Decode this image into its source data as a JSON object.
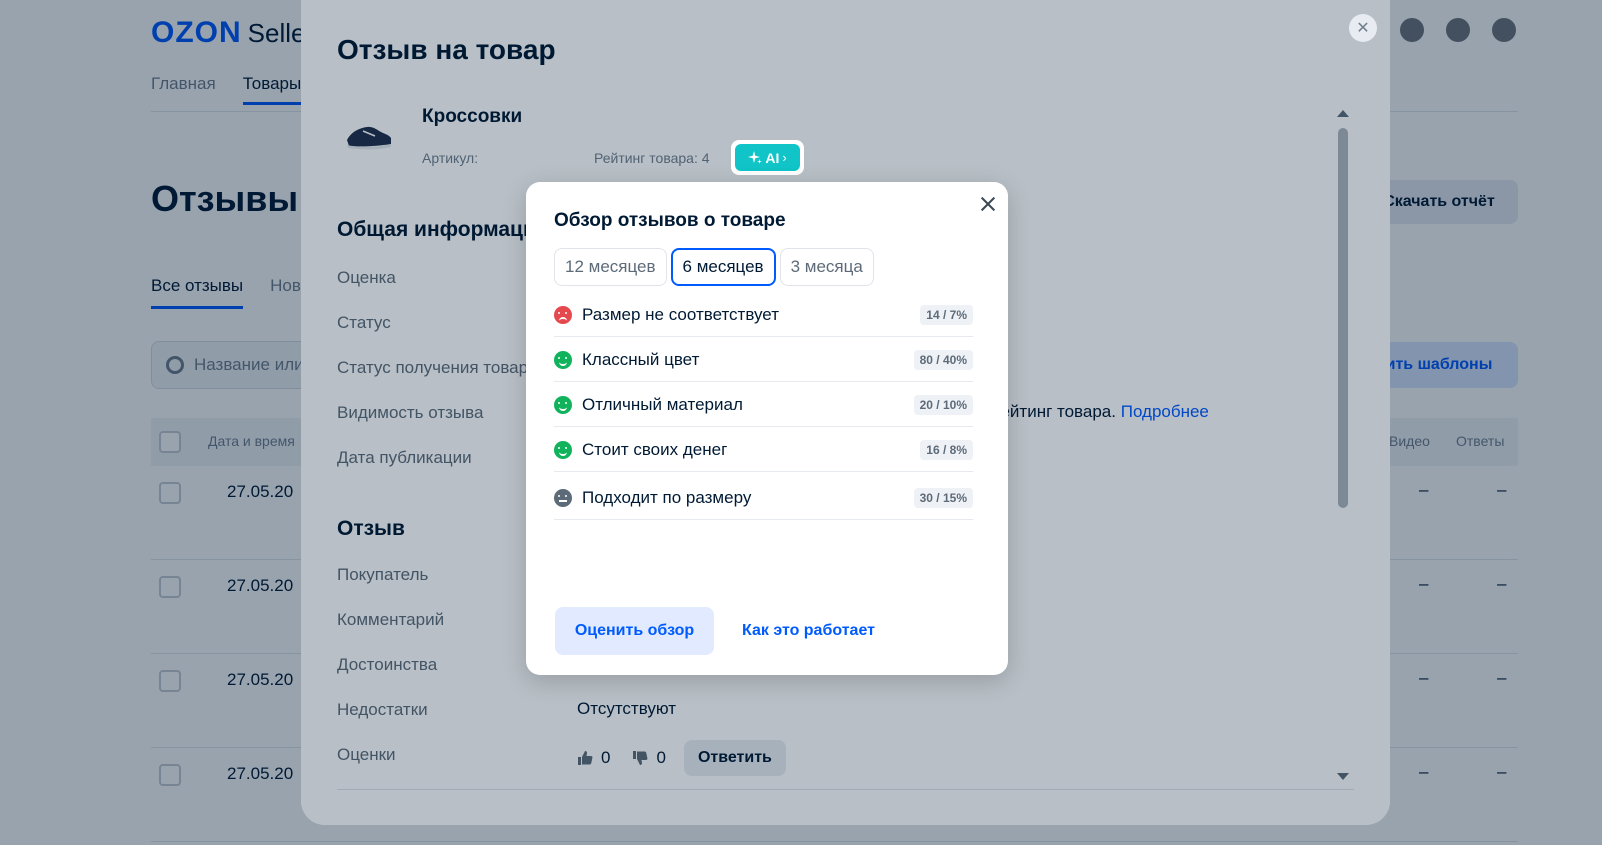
{
  "background": {
    "logo": "OZON",
    "logo_suffix": "Selle",
    "nav": [
      "Главная",
      "Товары"
    ],
    "page_title": "Отзывы",
    "download_label": "Скачать отчёт",
    "tabs": [
      "Все отзывы",
      "Нов"
    ],
    "search_placeholder": "Название или",
    "templates_label": "ить шаблоны",
    "table_headers": {
      "date": "Дата и время",
      "video": "Видео",
      "answers": "Ответы"
    },
    "rows": [
      {
        "date": "27.05.20",
        "video": "–",
        "answers": "–"
      },
      {
        "date": "27.05.20",
        "video": "–",
        "answers": "–"
      },
      {
        "date": "27.05.20",
        "video": "–",
        "answers": "–"
      },
      {
        "date": "27.05.20",
        "video": "–",
        "answers": "–"
      }
    ]
  },
  "drawer": {
    "title": "Отзыв на товар",
    "close_icon": "close-icon",
    "product": {
      "name": "Кроссовки",
      "article_label": "Артикул:",
      "rating_label": "Рейтинг товара: 4",
      "ai_badge": "AI",
      "ai_chevron": "›"
    },
    "general_section": "Общая информаци",
    "general_labels": [
      "Оценка",
      "Статус",
      "Статус получения товар",
      "Видимость отзыва",
      "Дата публикации"
    ],
    "visibility_text": "рейтинг товара.",
    "visibility_link": "Подробнее",
    "review_section": "Отзыв",
    "review_labels": [
      "Покупатель",
      "Комментарий",
      "Достоинства",
      "Недостатки",
      "Оценки"
    ],
    "defects_value": "Отсутствуют",
    "likes": "0",
    "dislikes": "0",
    "reply_label": "Ответить"
  },
  "popup": {
    "title": "Обзор отзывов о товаре",
    "periods": [
      {
        "label": "12 месяцев",
        "selected": false
      },
      {
        "label": "6 месяцев",
        "selected": true
      },
      {
        "label": "3 месяца",
        "selected": false
      }
    ],
    "topics": [
      {
        "name": "Размер не соответствует",
        "stat": "14 / 7%",
        "sentiment": "neg"
      },
      {
        "name": "Классный цвет",
        "stat": "80 / 40%",
        "sentiment": "pos"
      },
      {
        "name": "Отличный материал",
        "stat": "20 / 10%",
        "sentiment": "pos"
      },
      {
        "name": "Стоит своих денег",
        "stat": "16 / 8%",
        "sentiment": "pos"
      },
      {
        "name": "Подходит по размеру",
        "stat": "30 / 15%",
        "sentiment": "neu"
      }
    ],
    "rate_button": "Оценить обзор",
    "how_link": "Как это работает"
  },
  "colors": {
    "accent": "#005bff",
    "ai_badge": "#10c4c8",
    "positive": "#10b35c",
    "negative": "#e5484d",
    "neutral": "#5d6b79"
  }
}
